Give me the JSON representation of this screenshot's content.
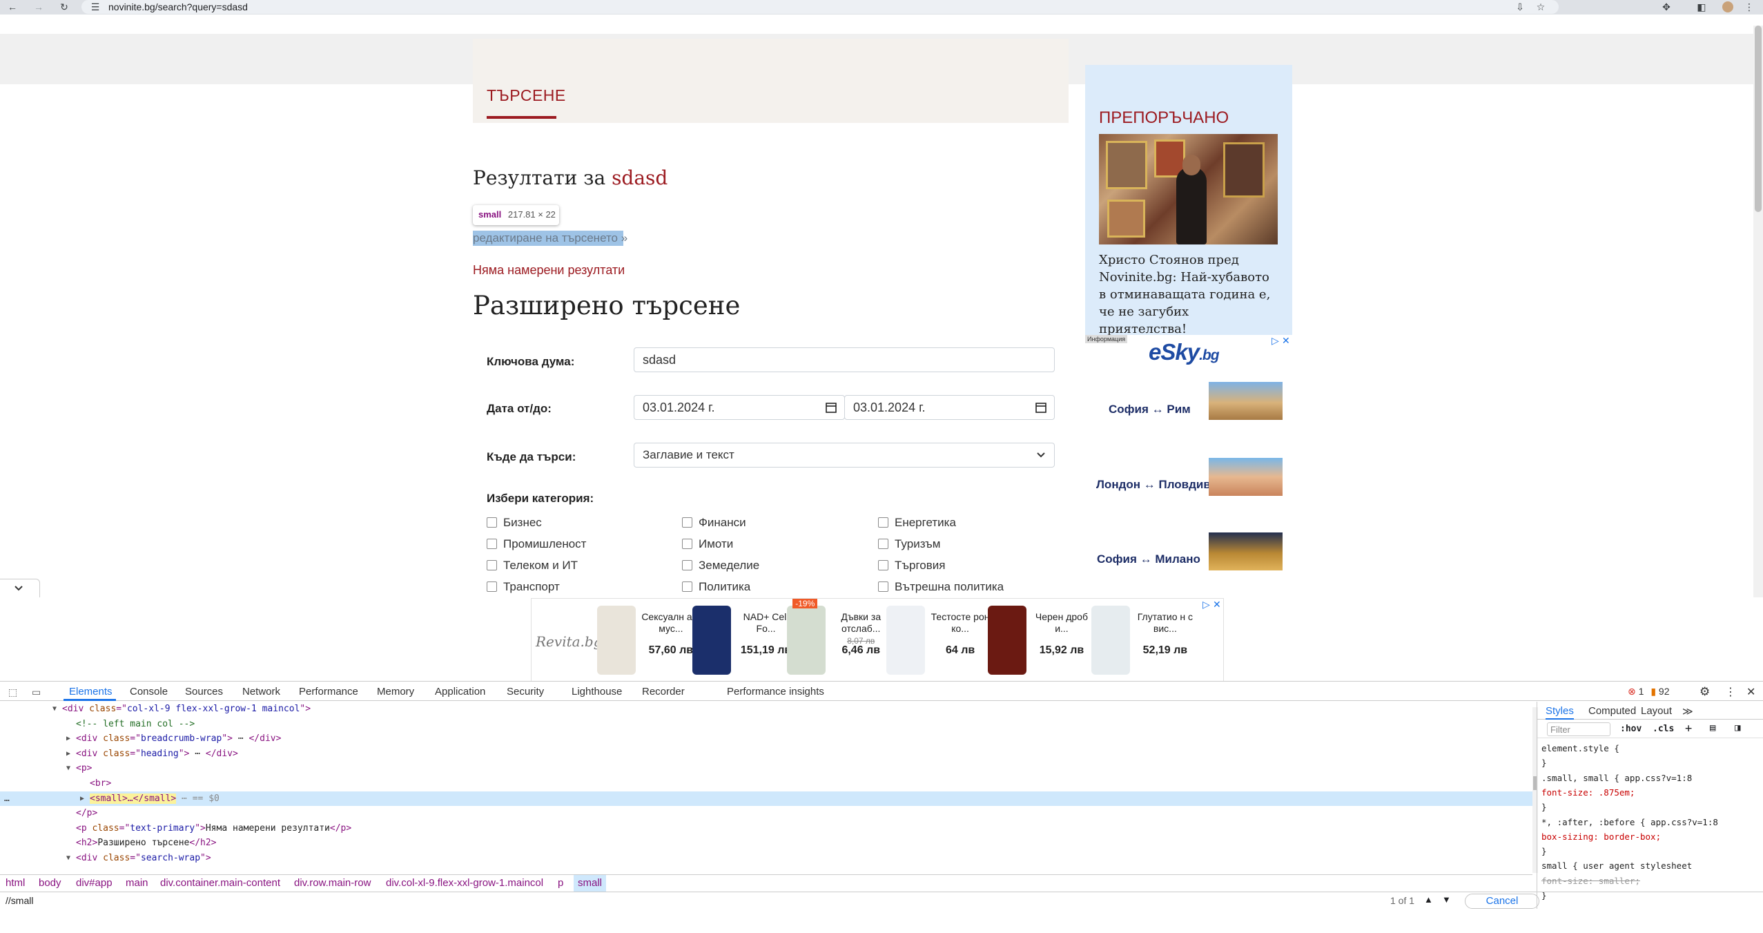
{
  "browser": {
    "url": "novinite.bg/search?query=sdasd"
  },
  "page": {
    "heading": "ТЪРСЕНЕ",
    "results_prefix": "Резултати за",
    "query": "sdasd",
    "tooltip_tag": "small",
    "tooltip_size": "217.81 × 22",
    "edit_search": "редактиране на търсенето »",
    "no_results": "Няма намерени резултати",
    "advanced_title": "Разширено търсене",
    "form": {
      "keyword_label": "Ключова дума:",
      "keyword_value": "sdasd",
      "date_label": "Дата от/до:",
      "date_from": "03.01.2024 г.",
      "date_to": "03.01.2024 г.",
      "where_label": "Къде да търси:",
      "where_value": "Заглавие и текст",
      "category_label": "Избери категория:",
      "categories": [
        "Бизнес",
        "Финанси",
        "Енергетика",
        "Промишленост",
        "Имоти",
        "Туризъм",
        "Телеком и ИТ",
        "Земеделие",
        "Търговия",
        "Транспорт",
        "Политика",
        "Вътрешна политика"
      ]
    }
  },
  "sidebar": {
    "title": "ПРЕПОРЪЧАНО",
    "article": "Христо Стоянов пред Novinite.bg: Най-хубавото в отминаващата година е, че не загубих приятелства!",
    "ad_info": "Информация",
    "ad_logo": "eSky",
    "ad_logo_suffix": ".bg",
    "routes": [
      "София ↔ Рим",
      "Лондон ↔ Пловдив",
      "София ↔ Милано"
    ]
  },
  "bottom_ad": {
    "logo": "Revita.bg",
    "products": [
      {
        "name": "Сексуалн а и мус...",
        "old": "",
        "price": "57,60 лв",
        "badge": "",
        "color": "#e9e4da"
      },
      {
        "name": "NAD+ Cell Fo...",
        "old": "",
        "price": "151,19 лв",
        "badge": "",
        "color": "#1b2f6b"
      },
      {
        "name": "Дъвки за отслаб...",
        "old": "8,07 лв",
        "price": "6,46 лв",
        "badge": "-19%",
        "color": "#d4ddd0"
      },
      {
        "name": "Тестосте рон ко...",
        "old": "",
        "price": "64 лв",
        "badge": "",
        "color": "#eef1f5"
      },
      {
        "name": "Черен дроб и...",
        "old": "",
        "price": "15,92 лв",
        "badge": "",
        "color": "#6b1a12"
      },
      {
        "name": "Глутатио н с вис...",
        "old": "",
        "price": "52,19 лв",
        "badge": "",
        "color": "#e6ecef"
      }
    ]
  },
  "devtools": {
    "tabs": [
      "Elements",
      "Console",
      "Sources",
      "Network",
      "Performance",
      "Memory",
      "Application",
      "Security",
      "Lighthouse",
      "Recorder",
      "Performance insights"
    ],
    "errors": "1",
    "warnings": "92",
    "dom": [
      {
        "indent": 4,
        "tri": "▼",
        "parts": [
          [
            "tg",
            "<div "
          ],
          [
            "at",
            "class"
          ],
          [
            "tg",
            "=\""
          ],
          [
            "av",
            "col-xl-9 flex-xxl-grow-1 maincol"
          ],
          [
            "tg",
            "\">"
          ]
        ]
      },
      {
        "indent": 5,
        "tri": "",
        "parts": [
          [
            "cm",
            "<!-- left main col -->"
          ]
        ]
      },
      {
        "indent": 5,
        "tri": "▶",
        "parts": [
          [
            "tg",
            "<div "
          ],
          [
            "at",
            "class"
          ],
          [
            "tg",
            "=\""
          ],
          [
            "av",
            "breadcrumb-wrap"
          ],
          [
            "tg",
            "\">"
          ],
          [
            "tx",
            " ⋯ "
          ],
          [
            "tg",
            "</div>"
          ]
        ]
      },
      {
        "indent": 5,
        "tri": "▶",
        "parts": [
          [
            "tg",
            "<div "
          ],
          [
            "at",
            "class"
          ],
          [
            "tg",
            "=\""
          ],
          [
            "av",
            "heading"
          ],
          [
            "tg",
            "\">"
          ],
          [
            "tx",
            " ⋯ "
          ],
          [
            "tg",
            "</div>"
          ]
        ]
      },
      {
        "indent": 5,
        "tri": "▼",
        "parts": [
          [
            "tg",
            "<p>"
          ]
        ]
      },
      {
        "indent": 6,
        "tri": "",
        "parts": [
          [
            "tg",
            "<br>"
          ]
        ]
      },
      {
        "indent": 6,
        "tri": "▶",
        "parts": [
          [
            "hl",
            "<small>…</small>"
          ],
          [
            "tx",
            " ⋯ == $0"
          ]
        ]
      },
      {
        "indent": 5,
        "tri": "",
        "parts": [
          [
            "tg",
            "</p>"
          ]
        ]
      },
      {
        "indent": 5,
        "tri": "",
        "parts": [
          [
            "tg",
            "<p "
          ],
          [
            "at",
            "class"
          ],
          [
            "tg",
            "=\""
          ],
          [
            "av",
            "text-primary"
          ],
          [
            "tg",
            "\">"
          ],
          [
            "tx",
            "Няма намерени резултати"
          ],
          [
            "tg",
            "</p>"
          ]
        ]
      },
      {
        "indent": 5,
        "tri": "",
        "parts": [
          [
            "tg",
            "<h2>"
          ],
          [
            "tx",
            "Разширено търсене"
          ],
          [
            "tg",
            "</h2>"
          ]
        ]
      },
      {
        "indent": 5,
        "tri": "▼",
        "parts": [
          [
            "tg",
            "<div "
          ],
          [
            "at",
            "class"
          ],
          [
            "tg",
            "=\""
          ],
          [
            "av",
            "search-wrap"
          ],
          [
            "tg",
            "\">"
          ]
        ]
      }
    ],
    "styles_tabs": [
      "Styles",
      "Computed",
      "Layout"
    ],
    "filter_placeholder": "Filter",
    "hov": ":hov",
    "cls": ".cls",
    "styles": [
      "element.style {",
      "}",
      ".small, small {        app.css?v=1:8",
      "  font-size: .875em;",
      "}",
      "*, :after, :before {   app.css?v=1:8",
      "  box-sizing: border-box;",
      "}",
      "small {     user agent stylesheet",
      "  font-size: smaller;",
      "}"
    ],
    "breadcrumbs": [
      "html",
      "body",
      "div#app",
      "main",
      "div.container.main-content",
      "div.row.main-row",
      "div.col-xl-9.flex-xxl-grow-1.maincol",
      "p",
      "small"
    ],
    "find_query": "//small",
    "find_count": "1 of 1",
    "cancel": "Cancel"
  }
}
